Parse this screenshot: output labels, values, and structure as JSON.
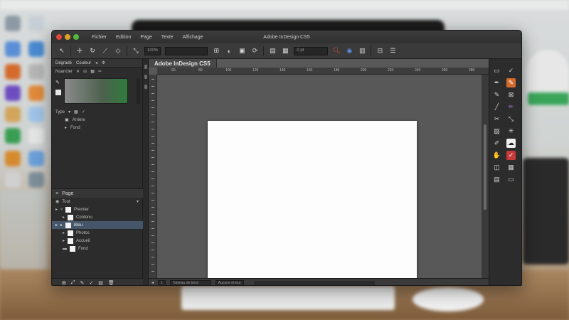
{
  "app": {
    "window_title": "Adobe InDesign CS5",
    "menu": [
      "Fichier",
      "Edition",
      "Page",
      "Texte",
      "Affichage"
    ]
  },
  "control_bar": {
    "zoom_value": "100%",
    "x_value": "",
    "stroke_value": "0 pt"
  },
  "left_panel": {
    "tabs": [
      "Dégradé",
      "Couleur"
    ],
    "subtabs": [
      "Nuancier",
      "Type"
    ],
    "type_label": "Type",
    "layers": [
      "Arrière",
      "Fond"
    ]
  },
  "pages_panel": {
    "title": "Page",
    "header_label": "Tout",
    "items": [
      "Premier",
      "Contenu",
      "Bleu",
      "Photos",
      "Accueil",
      "Fond"
    ],
    "selected_index": 2
  },
  "document": {
    "tab_title": "Adobe InDesign CS5",
    "ruler_marks": [
      "60",
      "80",
      "100",
      "120",
      "140",
      "160",
      "180",
      "200",
      "220",
      "240",
      "260",
      "280"
    ]
  },
  "status_bar": {
    "page_field": "1",
    "style_field": "Tableau de bord",
    "info_field": "Aucune erreur"
  },
  "colors": {
    "accent_selection": "#46566a",
    "close": "#e0443e",
    "minimize": "#dea123",
    "maximize": "#52b83a"
  }
}
